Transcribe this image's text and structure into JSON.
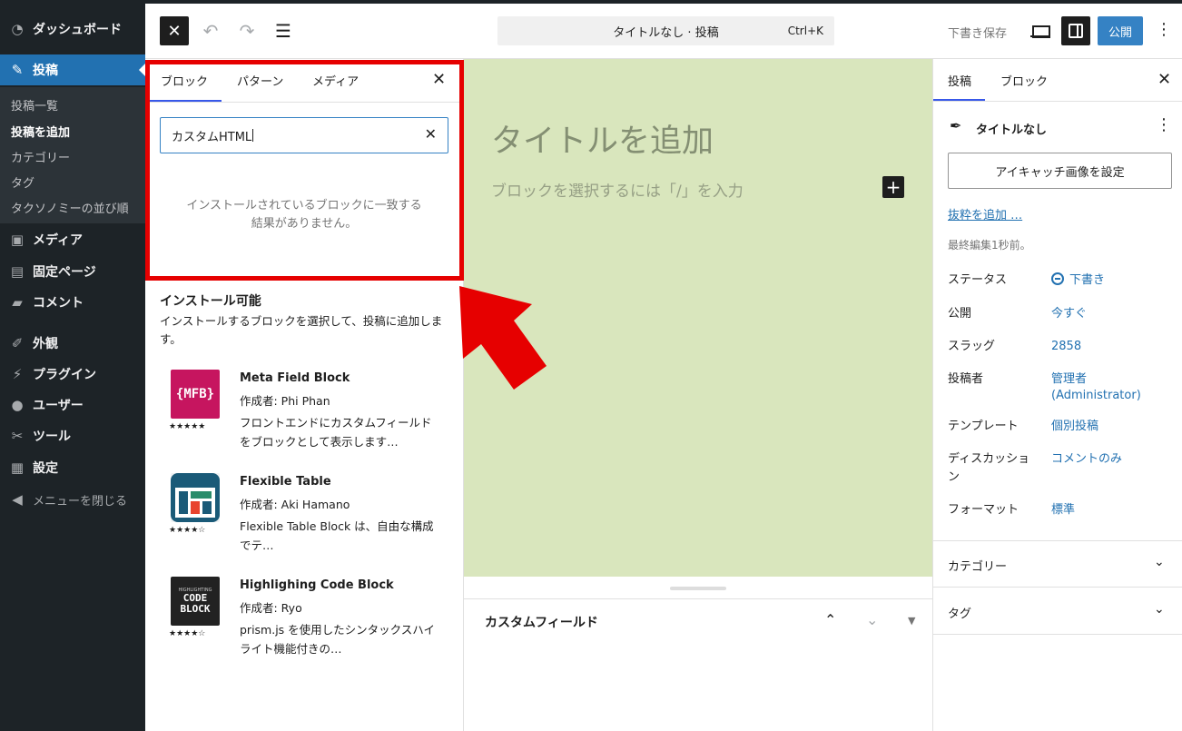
{
  "admin_menu": {
    "items": [
      {
        "label": "ダッシュボード",
        "icon": "dashboard-icon"
      },
      {
        "label": "投稿",
        "icon": "pin-icon"
      },
      {
        "label": "メディア",
        "icon": "media-icon"
      },
      {
        "label": "固定ページ",
        "icon": "pages-icon"
      },
      {
        "label": "コメント",
        "icon": "comment-icon"
      },
      {
        "label": "外観",
        "icon": "appearance-icon"
      },
      {
        "label": "プラグイン",
        "icon": "plugin-icon"
      },
      {
        "label": "ユーザー",
        "icon": "users-icon"
      },
      {
        "label": "ツール",
        "icon": "tools-icon"
      },
      {
        "label": "設定",
        "icon": "settings-icon"
      }
    ],
    "submenu": [
      "投稿一覧",
      "投稿を追加",
      "カテゴリー",
      "タグ",
      "タクソノミーの並び順"
    ],
    "collapse_label": "メニューを閉じる"
  },
  "toolbar": {
    "document_title": "タイトルなし · 投稿",
    "shortcut": "Ctrl+K",
    "save_draft": "下書き保存",
    "publish": "公開"
  },
  "inserter": {
    "tabs": [
      "ブロック",
      "パターン",
      "メディア"
    ],
    "search_value": "カスタムHTML",
    "no_results": "インストールされているブロックに一致する結果がありません。",
    "install_title": "インストール可能",
    "install_desc": "インストールするブロックを選択して、投稿に追加します。",
    "plugins": [
      {
        "name": "Meta Field Block",
        "author": "作成者: Phi Phan",
        "desc": "フロントエンドにカスタムフィールドをブロックとして表示します…",
        "rating": 5,
        "logo_text": "{MFB}",
        "logo_color": "#c6155f"
      },
      {
        "name": "Flexible Table",
        "author": "作成者: Aki Hamano",
        "desc": "Flexible Table Block は、自由な構成でテ…",
        "rating": 4.5,
        "logo_color": "#1a5a78"
      },
      {
        "name": "Highlighing Code Block",
        "author": "作成者: Ryo",
        "desc": "prism.js を使用したシンタックスハイライト機能付きの…",
        "rating": 4.5,
        "logo_text": "CODE BLOCK",
        "logo_sub": "HIGHLIGHTING",
        "logo_color": "#222222"
      }
    ]
  },
  "canvas": {
    "title_placeholder": "タイトルを追加",
    "block_placeholder": "ブロックを選択するには「/」を入力",
    "background": "#d9e6bd"
  },
  "meta_box": {
    "title": "カスタムフィールド"
  },
  "settings": {
    "tabs": [
      "投稿",
      "ブロック"
    ],
    "post_title": "タイトルなし",
    "featured_image": "アイキャッチ画像を設定",
    "excerpt_link": "抜粋を追加 …",
    "last_edited": "最終編集1秒前。",
    "rows": [
      {
        "label": "ステータス",
        "value": "下書き"
      },
      {
        "label": "公開",
        "value": "今すぐ"
      },
      {
        "label": "スラッグ",
        "value": "2858"
      },
      {
        "label": "投稿者",
        "value": "管理者 (Administrator)"
      },
      {
        "label": "テンプレート",
        "value": "個別投稿"
      },
      {
        "label": "ディスカッション",
        "value": "コメントのみ"
      },
      {
        "label": "フォーマット",
        "value": "標準"
      }
    ],
    "panels": [
      "カテゴリー",
      "タグ"
    ]
  },
  "colors": {
    "accent": "#2271b1",
    "admin_bg": "#1d2327",
    "highlight": "#e60000"
  }
}
